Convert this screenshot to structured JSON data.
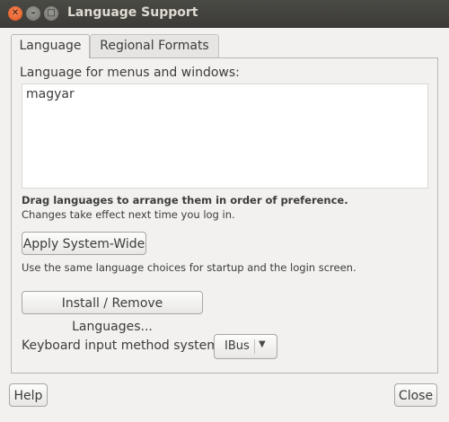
{
  "window": {
    "title": "Language Support",
    "controls": {
      "close_glyph": "✕",
      "minimize_glyph": "–",
      "maximize_glyph": "□"
    }
  },
  "tabs": [
    {
      "label": "Language",
      "active": true
    },
    {
      "label": "Regional Formats",
      "active": false
    }
  ],
  "language_tab": {
    "menus_label": "Language for menus and windows:",
    "languages": [
      "magyar"
    ],
    "hint_bold": "Drag languages to arrange them in order of preference.",
    "hint": "Changes take effect next time you log in.",
    "apply_button": "Apply System-Wide",
    "apply_description": "Use the same language choices for startup and the login screen.",
    "install_button": "Install / Remove Languages...",
    "keyboard_label": "Keyboard input method system:",
    "keyboard_value": "IBus",
    "keyboard_arrow": "▼"
  },
  "footer": {
    "help_button": "Help",
    "close_button": "Close"
  },
  "colors": {
    "titlebar": "#3c3b37",
    "close_button": "#e2531d",
    "window_bg": "#f2f1f0"
  }
}
